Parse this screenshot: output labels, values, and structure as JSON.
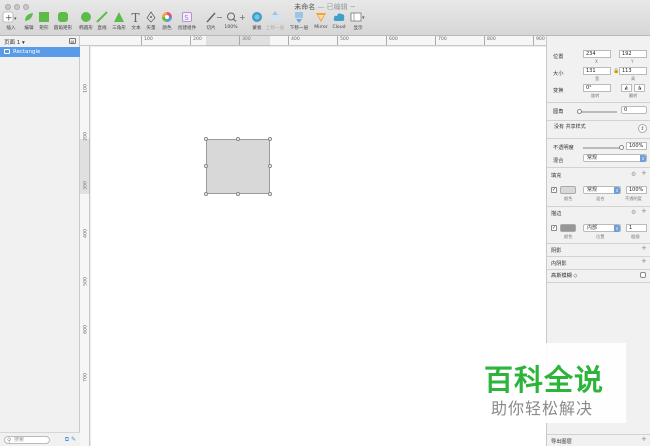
{
  "window": {
    "title": "未命名",
    "edited": "— 已编辑 ~"
  },
  "toolbar": {
    "insert": "插入",
    "edit": "编辑",
    "rectangle": "矩形",
    "rounded_rect": "圆角矩形",
    "oval": "椭圆形",
    "line": "直线",
    "triangle": "三角形",
    "text": "文本",
    "vector": "矢量",
    "color": "颜色",
    "create_symbol": "创建组件",
    "slice": "切片",
    "zoom": "100%",
    "mask": "蒙板",
    "move_up": "上移一层",
    "move_down": "下移一层",
    "mirror": "Mirror",
    "cloud": "Cloud",
    "view": "显示"
  },
  "layers": {
    "page_selector": "页面 1 ▾",
    "items": [
      {
        "name": "Rectangle"
      }
    ],
    "filter_placeholder": "搜索"
  },
  "rulers": {
    "top": [
      "100",
      "200",
      "300",
      "400",
      "500",
      "600",
      "700",
      "800",
      "900"
    ],
    "left": [
      "100",
      "200",
      "300",
      "400",
      "500",
      "600",
      "700"
    ]
  },
  "inspector": {
    "position_label": "位置",
    "x_value": "234",
    "y_value": "192",
    "x_label": "X",
    "y_label": "Y",
    "size_label": "大小",
    "width_value": "131",
    "height_value": "113",
    "width_label": "宽",
    "height_label": "高",
    "transform_label": "变换",
    "rotate_value": "0°",
    "rotate_label": "旋转",
    "flip_label": "翻转",
    "corner_label": "圆角",
    "corner_value": "0",
    "shared_style": "没有 共享样式",
    "opacity_label": "不透明度",
    "opacity_value": "100%",
    "blend_label": "混合",
    "blend_value": "常规",
    "fill_title": "填充",
    "fill_mode": "常规",
    "fill_opacity": "100%",
    "fill_sub_color": "颜色",
    "fill_sub_mode": "混合",
    "fill_sub_opacity": "不透明度",
    "fill_color": "#d8d8d8",
    "border_title": "描边",
    "border_position": "内部",
    "border_thickness": "1",
    "border_sub_color": "颜色",
    "border_sub_position": "位置",
    "border_sub_thickness": "粗细",
    "border_color": "#979797",
    "shadow_title": "阴影",
    "inner_shadow_title": "内阴影",
    "blur_title": "高斯模糊 ◇",
    "export_title": "导出图层"
  },
  "watermark": {
    "title": "百科全说",
    "subtitle": "助你轻松解决",
    "color": "#2db43a"
  },
  "colors": {
    "selection": "#5a9be7",
    "accent": "#6f9fd8"
  }
}
